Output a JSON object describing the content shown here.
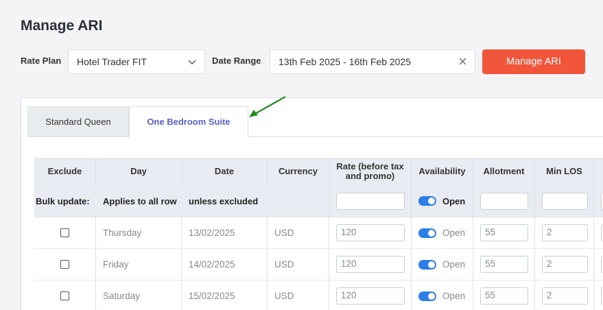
{
  "page": {
    "title": "Manage ARI"
  },
  "filters": {
    "rate_plan_label": "Rate Plan",
    "rate_plan_value": "Hotel Trader FIT",
    "date_range_label": "Date Range",
    "date_range_value": "13th Feb 2025 - 16th Feb 2025",
    "manage_button": "Manage ARI"
  },
  "tabs": [
    {
      "label": "Standard Queen",
      "active": false
    },
    {
      "label": "One Bedroom Suite",
      "active": true
    }
  ],
  "table": {
    "headers": {
      "exclude": "Exclude",
      "day": "Day",
      "date": "Date",
      "currency": "Currency",
      "rate": "Rate (before tax and promo)",
      "availability": "Availability",
      "allotment": "Allotment",
      "min_los": "Min LOS"
    },
    "bulk": {
      "label": "Bulk update:",
      "applies": "Applies to all row",
      "unless": "unless excluded",
      "availability": "Open"
    },
    "rows": [
      {
        "day": "Thursday",
        "date": "13/02/2025",
        "currency": "USD",
        "rate": "120",
        "availability": "Open",
        "allotment": "55",
        "min_los": "2"
      },
      {
        "day": "Friday",
        "date": "14/02/2025",
        "currency": "USD",
        "rate": "120",
        "availability": "Open",
        "allotment": "55",
        "min_los": "2"
      },
      {
        "day": "Saturday",
        "date": "15/02/2025",
        "currency": "USD",
        "rate": "120",
        "availability": "Open",
        "allotment": "55",
        "min_los": "2"
      }
    ]
  },
  "colors": {
    "accent": "#f1553a",
    "tab_active": "#5b5fc7",
    "toggle": "#2b7de9",
    "annotation_arrow": "#1e8a1e"
  },
  "icons": {
    "dropdown": "chevron-down-icon",
    "clear": "close-icon",
    "annotation": "arrow-icon"
  }
}
